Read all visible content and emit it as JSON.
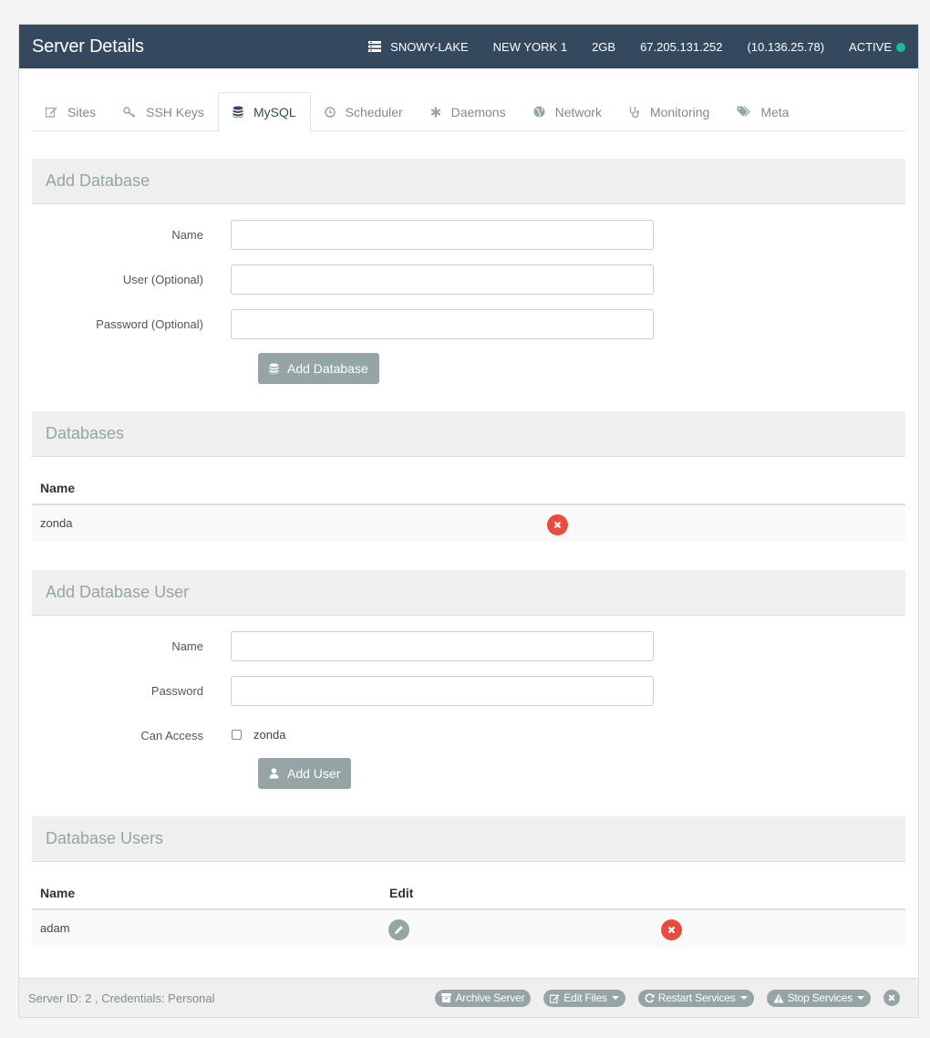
{
  "header": {
    "title": "Server Details",
    "server_name": "SNOWY-LAKE",
    "region": "NEW YORK 1",
    "size": "2GB",
    "public_ip": "67.205.131.252",
    "private_ip": "(10.136.25.78)",
    "status": "ACTIVE",
    "status_color": "#1abc9c"
  },
  "tabs": [
    {
      "label": "Sites",
      "icon": "edit-icon"
    },
    {
      "label": "SSH Keys",
      "icon": "key-icon"
    },
    {
      "label": "MySQL",
      "icon": "database-icon"
    },
    {
      "label": "Scheduler",
      "icon": "clock-icon"
    },
    {
      "label": "Daemons",
      "icon": "asterisk-icon"
    },
    {
      "label": "Network",
      "icon": "globe-icon"
    },
    {
      "label": "Monitoring",
      "icon": "stethoscope-icon"
    },
    {
      "label": "Meta",
      "icon": "tags-icon"
    }
  ],
  "active_tab": "MySQL",
  "add_database": {
    "heading": "Add Database",
    "name_label": "Name",
    "user_label": "User (Optional)",
    "password_label": "Password (Optional)",
    "name_value": "",
    "user_value": "",
    "password_value": "",
    "button_label": "Add Database"
  },
  "databases": {
    "heading": "Databases",
    "col_name": "Name",
    "rows": [
      {
        "name": "zonda"
      }
    ]
  },
  "add_user": {
    "heading": "Add Database User",
    "name_label": "Name",
    "password_label": "Password",
    "name_value": "",
    "password_value": "",
    "access_label": "Can Access",
    "access_option": "zonda",
    "button_label": "Add User"
  },
  "database_users": {
    "heading": "Database Users",
    "col_name": "Name",
    "col_edit": "Edit",
    "rows": [
      {
        "name": "adam"
      }
    ]
  },
  "footer": {
    "info": "Server ID: 2 , Credentials: Personal",
    "archive_label": "Archive Server",
    "edit_files_label": "Edit Files",
    "restart_label": "Restart Services",
    "stop_label": "Stop Services"
  },
  "colors": {
    "header_bg": "#34495e",
    "button_bg": "#95a5a6",
    "delete_red": "#e74c3c"
  }
}
